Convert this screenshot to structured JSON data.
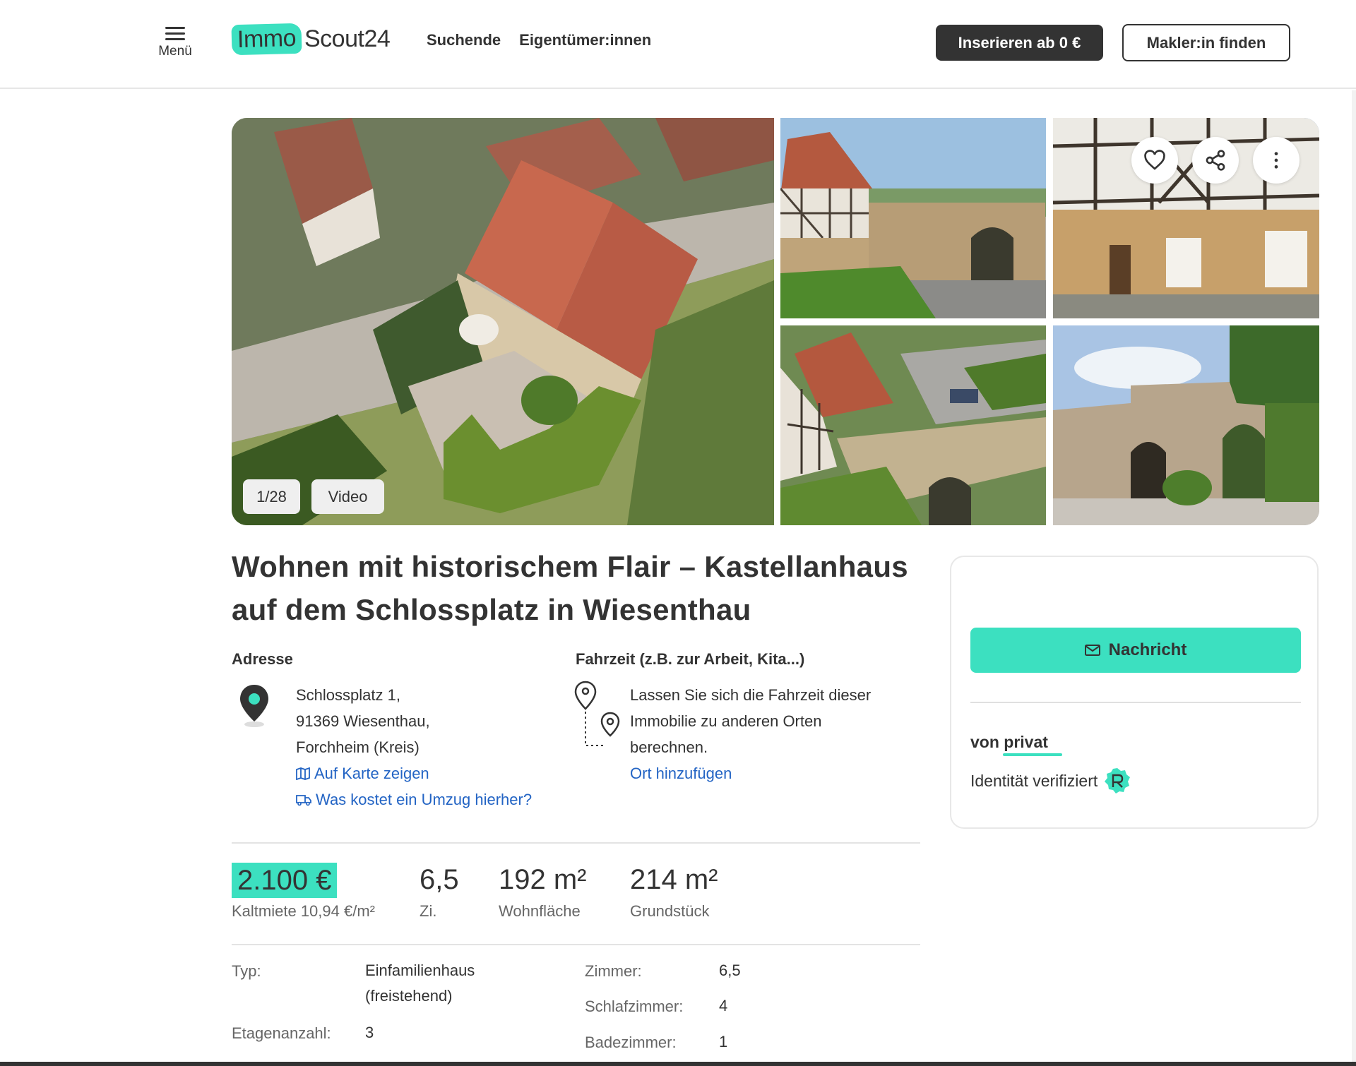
{
  "header": {
    "menu_label": "Menü",
    "logo_immo": "Immo",
    "logo_scout": "Scout24",
    "nav": [
      "Suchende",
      "Eigentümer:innen"
    ],
    "insert_button": "Inserieren ab 0 €",
    "makler_button": "Makler:in finden"
  },
  "gallery": {
    "counter": "1/28",
    "video_label": "Video",
    "icons": [
      "heart-icon",
      "share-icon",
      "more-vertical-icon"
    ]
  },
  "listing": {
    "title_line1": "Wohnen mit historischem Flair – Kastellanhaus",
    "title_line2": "auf dem Schlossplatz in Wiesenthau"
  },
  "address": {
    "heading": "Adresse",
    "line1": "Schlossplatz 1,",
    "line2": "91369 Wiesenthau,",
    "line3": "Forchheim (Kreis)",
    "map_link": "Auf Karte zeigen",
    "move_link": "Was kostet ein Umzug hierher?"
  },
  "commute": {
    "heading": "Fahrzeit (z.B. zur Arbeit, Kita...)",
    "line1": "Lassen Sie sich die Fahrzeit dieser",
    "line2": "Immobilie zu anderen Orten",
    "line3": "berechnen.",
    "add_link": "Ort hinzufügen"
  },
  "contact": {
    "message_button": "Nachricht",
    "von_prefix": "von ",
    "von_value": "privat",
    "identity": "Identität verifiziert"
  },
  "key_figures": {
    "price": "2.100 €",
    "price_label": "Kaltmiete 10,94 €/m²",
    "rooms": "6,5",
    "rooms_label": "Zi.",
    "living_area": "192 m²",
    "living_label": "Wohnfläche",
    "plot": "214 m²",
    "plot_label": "Grundstück"
  },
  "details": {
    "typ_label": "Typ:",
    "typ_line1": "Einfamilienhaus",
    "typ_line2": "(freistehend)",
    "etagen_label": "Etagenanzahl:",
    "etagen_value": "3",
    "zimmer_label": "Zimmer:",
    "zimmer_value": "6,5",
    "schlaf_label": "Schlafzimmer:",
    "schlaf_value": "4",
    "bad_label": "Badezimmer:",
    "bad_value": "1"
  },
  "colors": {
    "accent": "#3ce0c0",
    "dark": "#333333",
    "link": "#2364c4"
  }
}
